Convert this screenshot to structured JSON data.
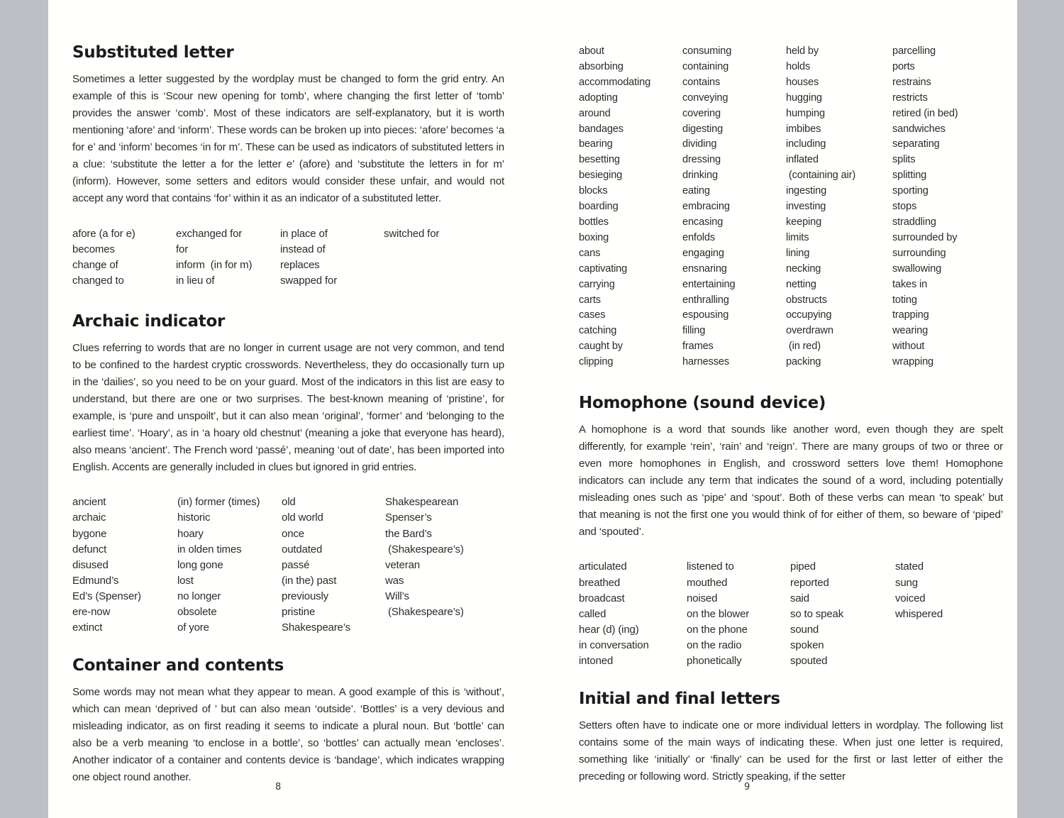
{
  "background": {
    "outer_color": "#bcbfc4",
    "paper_color": "#fffffd",
    "text_color": "#2b2b2b"
  },
  "left_page": {
    "page_number": "8",
    "sections": [
      {
        "id": "substituted-letter",
        "title": "Substituted letter",
        "body": "Sometimes a letter suggested by the wordplay must be changed to form the grid entry. An example of this is ‘Scour new opening for tomb’, where changing the first letter of ‘tomb’ provides the answer ‘comb’. Most of these indicators are self-explanatory, but it is worth mentioning ‘afore’ and ‘inform’. These words can be broken up into pieces: ‘afore’ becomes ‘a for e’ and ‘inform’ becomes ‘in for m’. These can be used as indicators of substituted letters in a clue: ‘substitute the letter a for the letter e’ (afore) and ‘substitute the letters in for m’ (inform). However, some setters and editors would consider these unfair, and would not accept any word that contains ‘for’ within it as an indicator of a substituted letter.",
        "word_columns": [
          [
            "afore (a for e)",
            "becomes",
            "change of",
            "changed to"
          ],
          [
            "exchanged for",
            "for",
            "inform  (in for m)",
            "in lieu of"
          ],
          [
            "in place of",
            "instead of",
            "replaces",
            "swapped for"
          ],
          [
            "switched for"
          ]
        ]
      },
      {
        "id": "archaic-indicator",
        "title": "Archaic indicator",
        "body": "Clues referring to words that are no longer in current usage are not very common, and tend to be confined to the hardest cryptic crosswords. Nevertheless, they do occasionally turn up in the ‘dailies’, so you need to be on your guard. Most of the indicators in this list are easy to understand, but there are one or two surprises. The best-known meaning of ‘pristine’, for example, is ‘pure and unspoilt’, but it can also mean ‘original’, ‘former’ and ‘belonging to the earliest time’. ‘Hoary’, as in ‘a hoary old chestnut’ (meaning a joke that everyone has heard), also means ‘ancient’. The French word ‘passé’, meaning ‘out of date’, has been imported into English. Accents are generally included in clues but ignored in grid entries.",
        "word_columns": [
          [
            "ancient",
            "archaic",
            "bygone",
            "defunct",
            "disused",
            "Edmund’s",
            "Ed’s (Spenser)",
            "ere-now",
            "extinct"
          ],
          [
            "(in) former (times)",
            "historic",
            "hoary",
            "in olden times",
            "long gone",
            "lost",
            "no longer",
            "obsolete",
            "of yore"
          ],
          [
            "old",
            "old world",
            "once",
            "outdated",
            "passé",
            "(in the) past",
            "previously",
            "pristine",
            "Shakespeare’s"
          ],
          [
            "Shakespearean",
            "Spenser’s",
            "the Bard’s",
            " (Shakespeare’s)",
            "veteran",
            "was",
            "Will’s",
            " (Shakespeare’s)"
          ]
        ]
      },
      {
        "id": "container-and-contents",
        "title": "Container and contents",
        "body": "Some words may not mean what they appear to mean. A good example of this is ‘without’, which can mean ‘deprived of ’ but can also mean ‘outside’. ‘Bottles’ is a very devious and misleading indicator, as on first reading it seems to indicate a plural noun. But ‘bottle’ can also be a verb meaning ‘to enclose in a bottle’, so ‘bottles’ can actually mean ‘encloses’. Another indicator of a container and contents device is ‘bandage’, which indicates wrapping one object round another.",
        "word_columns": []
      }
    ]
  },
  "right_page": {
    "page_number": "9",
    "container_word_columns": [
      [
        "about",
        "absorbing",
        "accommodating",
        "adopting",
        "around",
        "bandages",
        "bearing",
        "besetting",
        "besieging",
        "blocks",
        "boarding",
        "bottles",
        "boxing",
        "cans",
        "captivating",
        "carrying",
        "carts",
        "cases",
        "catching",
        "caught by",
        "clipping"
      ],
      [
        "consuming",
        "containing",
        "contains",
        "conveying",
        "covering",
        "digesting",
        "dividing",
        "dressing",
        "drinking",
        "eating",
        "embracing",
        "encasing",
        "enfolds",
        "engaging",
        "ensnaring",
        "entertaining",
        "enthralling",
        "espousing",
        "filling",
        "frames",
        "harnesses"
      ],
      [
        "held by",
        "holds",
        "houses",
        "hugging",
        "humping",
        "imbibes",
        "including",
        "inflated",
        " (containing air)",
        "ingesting",
        "investing",
        "keeping",
        "limits",
        "lining",
        "necking",
        "netting",
        "obstructs",
        "occupying",
        "overdrawn",
        " (in red)",
        "packing"
      ],
      [
        "parcelling",
        "ports",
        "restrains",
        "restricts",
        "retired (in bed)",
        "sandwiches",
        "separating",
        "splits",
        "splitting",
        "sporting",
        "stops",
        "straddling",
        "surrounded by",
        "surrounding",
        "swallowing",
        "takes in",
        "toting",
        "trapping",
        "wearing",
        "without",
        "wrapping"
      ]
    ],
    "sections": [
      {
        "id": "homophone",
        "title": "Homophone (sound device)",
        "body": "A homophone is a word that sounds like another word, even though they are spelt differently, for example ‘rein’, ‘rain’ and ‘reign’. There are many groups of two or three or even more homophones in English, and crossword setters love them! Homophone indicators can include any term that indicates the sound of a word, including potentially misleading ones such as ‘pipe’ and ‘spout’. Both of these verbs can mean ‘to speak’ but that meaning is not the first one you would think of for either of them, so beware of ‘piped’ and ‘spouted’.",
        "word_columns": [
          [
            "articulated",
            "breathed",
            "broadcast",
            "called",
            "hear (d) (ing)",
            "in conversation",
            "intoned"
          ],
          [
            "listened to",
            "mouthed",
            "noised",
            "on the blower",
            "on the phone",
            "on the radio",
            "phonetically"
          ],
          [
            "piped",
            "reported",
            "said",
            "so to speak",
            "sound",
            "spoken",
            "spouted"
          ],
          [
            "stated",
            "sung",
            "voiced",
            "whispered"
          ]
        ]
      },
      {
        "id": "initial-and-final-letters",
        "title": "Initial and final letters",
        "body": "Setters often have to indicate one or more individual letters in wordplay. The following list contains some of the main ways of indicating these. When just one letter is required, something like ‘initially’ or ‘finally’ can be used for the first or last letter of either the preceding or following word. Strictly speaking, if the setter",
        "word_columns": []
      }
    ]
  }
}
